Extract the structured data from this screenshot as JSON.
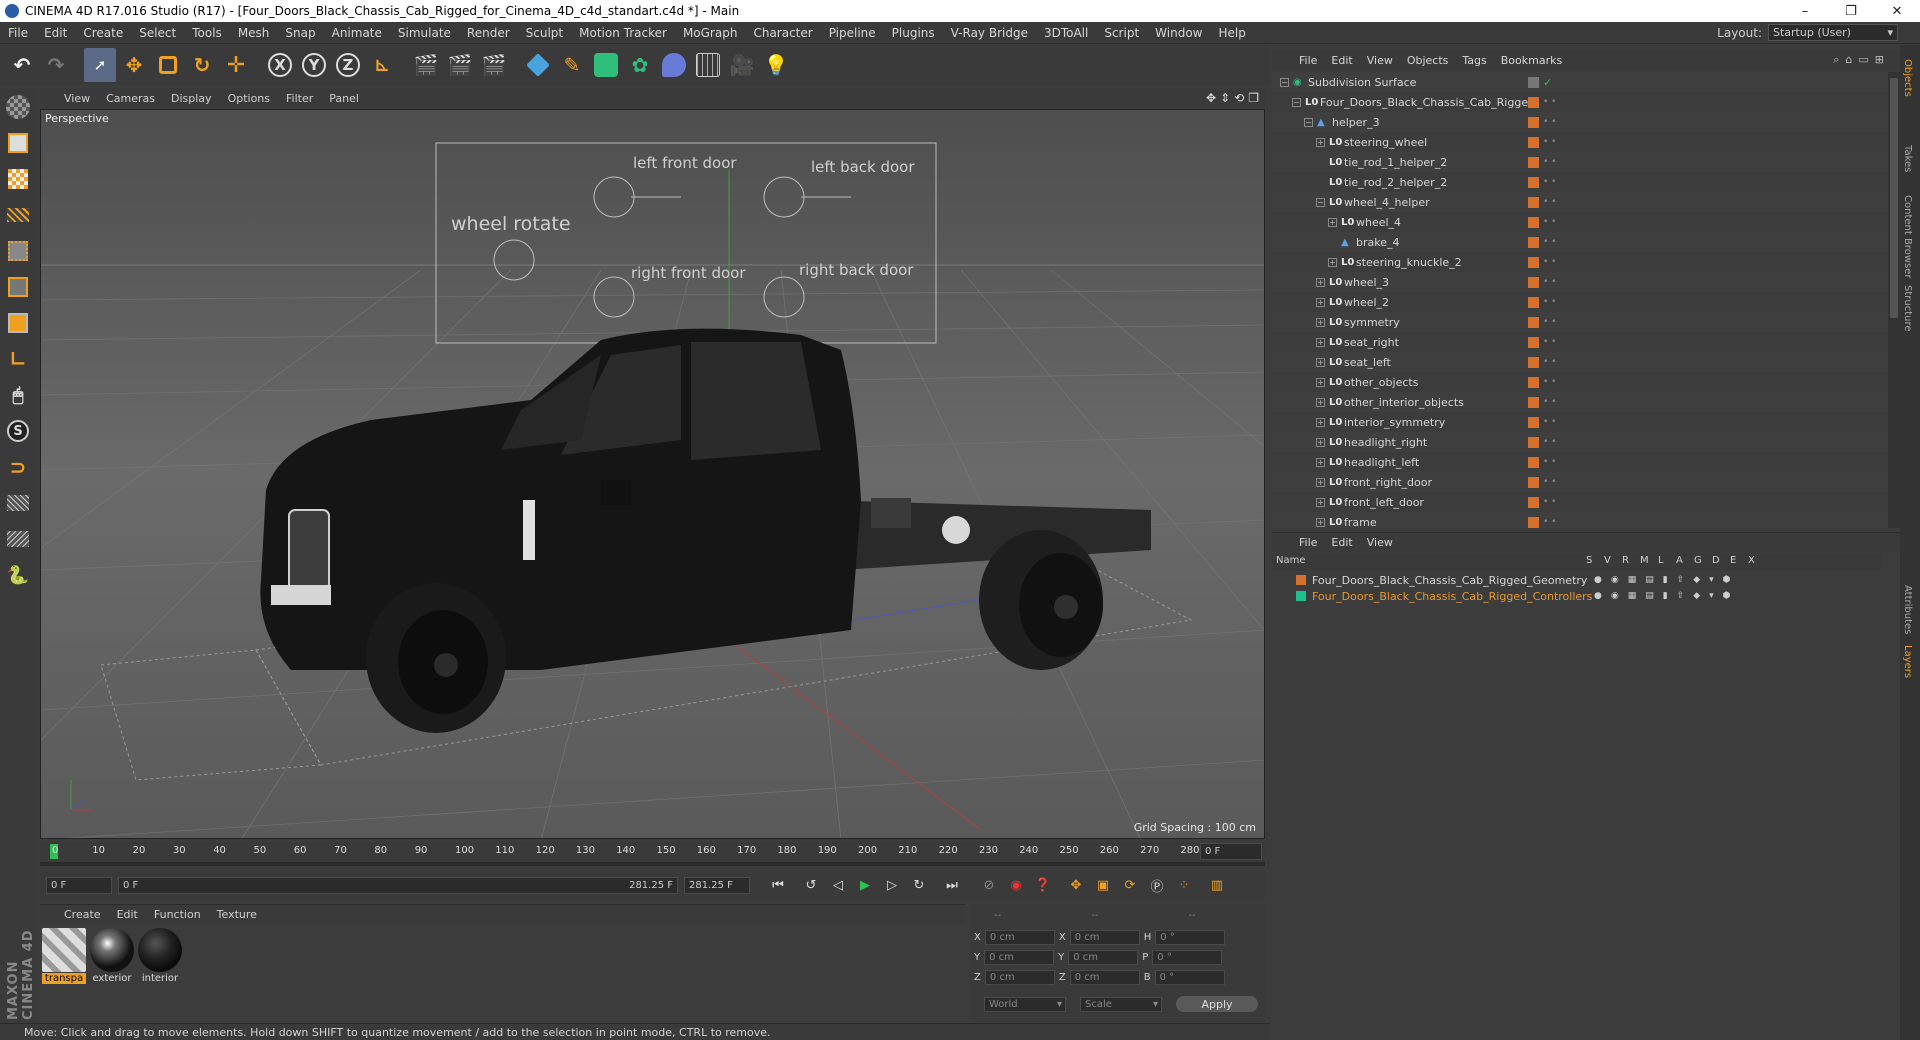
{
  "window": {
    "title": "CINEMA 4D R17.016 Studio (R17) - [Four_Doors_Black_Chassis_Cab_Rigged_for_Cinema_4D_c4d_standart.c4d *] - Main",
    "minimize": "–",
    "restore": "❐",
    "close": "✕"
  },
  "menubar": {
    "items": [
      "File",
      "Edit",
      "Create",
      "Select",
      "Tools",
      "Mesh",
      "Snap",
      "Animate",
      "Simulate",
      "Render",
      "Sculpt",
      "Motion Tracker",
      "MoGraph",
      "Character",
      "Pipeline",
      "Plugins",
      "V-Ray Bridge",
      "3DToAll",
      "Script",
      "Window",
      "Help"
    ],
    "layout_label": "Layout:",
    "layout_value": "Startup (User)"
  },
  "viewport": {
    "menu": [
      "View",
      "Cameras",
      "Display",
      "Options",
      "Filter",
      "Panel"
    ],
    "camera_label": "Perspective",
    "grid_spacing": "Grid Spacing : 100 cm",
    "rig_labels": {
      "wheel_rotate": "wheel rotate",
      "left_front_door": "left front door",
      "left_back_door": "left back door",
      "right_front_door": "right front door",
      "right_back_door": "right back door"
    }
  },
  "timeline": {
    "ticks": [
      "0",
      "10",
      "20",
      "30",
      "40",
      "50",
      "60",
      "70",
      "80",
      "90",
      "100",
      "110",
      "120",
      "130",
      "140",
      "150",
      "160",
      "170",
      "180",
      "190",
      "200",
      "210",
      "220",
      "230",
      "240",
      "250",
      "260",
      "270",
      "280"
    ],
    "current_frame": "0 F",
    "start_frame": "0 F",
    "slider_start": "0 F",
    "slider_end": "281.25 F",
    "end_frame": "281.25 F"
  },
  "materials": {
    "menu": [
      "Create",
      "Edit",
      "Function",
      "Texture"
    ],
    "items": [
      {
        "label": "transpa",
        "selected": true
      },
      {
        "label": "exterior",
        "selected": false
      },
      {
        "label": "interior",
        "selected": false
      }
    ]
  },
  "coordinates": {
    "headers": [
      "--",
      "--",
      "--"
    ],
    "rows": [
      {
        "a": "X",
        "av": "0 cm",
        "b": "X",
        "bv": "0 cm",
        "c": "H",
        "cv": "0 °"
      },
      {
        "a": "Y",
        "av": "0 cm",
        "b": "Y",
        "bv": "0 cm",
        "c": "P",
        "cv": "0 °"
      },
      {
        "a": "Z",
        "av": "0 cm",
        "b": "Z",
        "bv": "0 cm",
        "c": "B",
        "cv": "0 °"
      }
    ],
    "mode": "World",
    "transform": "Scale",
    "apply": "Apply"
  },
  "status": "Move: Click and drag to move elements. Hold down SHIFT to quantize movement / add to the selection in point mode, CTRL to remove.",
  "object_manager": {
    "menu": [
      "File",
      "Edit",
      "View",
      "Objects",
      "Tags",
      "Bookmarks"
    ],
    "rows": [
      {
        "name": "Subdivision Surface",
        "indent": 0,
        "icon": "subdiv",
        "expand": "−"
      },
      {
        "name": "Four_Doors_Black_Chassis_Cab_Rigged",
        "indent": 1,
        "icon": "null",
        "expand": "−"
      },
      {
        "name": "helper_3",
        "indent": 2,
        "icon": "joint",
        "expand": "−"
      },
      {
        "name": "steering_wheel",
        "indent": 3,
        "icon": "null",
        "expand": "+"
      },
      {
        "name": "tie_rod_1_helper_2",
        "indent": 3,
        "icon": "null",
        "expand": ""
      },
      {
        "name": "tie_rod_2_helper_2",
        "indent": 3,
        "icon": "null",
        "expand": ""
      },
      {
        "name": "wheel_4_helper",
        "indent": 3,
        "icon": "null",
        "expand": "−"
      },
      {
        "name": "wheel_4",
        "indent": 4,
        "icon": "null",
        "expand": "+"
      },
      {
        "name": "brake_4",
        "indent": 4,
        "icon": "joint",
        "expand": ""
      },
      {
        "name": "steering_knuckle_2",
        "indent": 4,
        "icon": "null",
        "expand": "+"
      },
      {
        "name": "wheel_3",
        "indent": 3,
        "icon": "null",
        "expand": "+"
      },
      {
        "name": "wheel_2",
        "indent": 3,
        "icon": "null",
        "expand": "+"
      },
      {
        "name": "symmetry",
        "indent": 3,
        "icon": "null",
        "expand": "+"
      },
      {
        "name": "seat_right",
        "indent": 3,
        "icon": "null",
        "expand": "+"
      },
      {
        "name": "seat_left",
        "indent": 3,
        "icon": "null",
        "expand": "+"
      },
      {
        "name": "other_objects",
        "indent": 3,
        "icon": "null",
        "expand": "+"
      },
      {
        "name": "other_interior_objects",
        "indent": 3,
        "icon": "null",
        "expand": "+"
      },
      {
        "name": "interior_symmetry",
        "indent": 3,
        "icon": "null",
        "expand": "+"
      },
      {
        "name": "headlight_right",
        "indent": 3,
        "icon": "null",
        "expand": "+"
      },
      {
        "name": "headlight_left",
        "indent": 3,
        "icon": "null",
        "expand": "+"
      },
      {
        "name": "front_right_door",
        "indent": 3,
        "icon": "null",
        "expand": "+"
      },
      {
        "name": "front_left_door",
        "indent": 3,
        "icon": "null",
        "expand": "+"
      },
      {
        "name": "frame",
        "indent": 3,
        "icon": "null",
        "expand": "+"
      }
    ]
  },
  "layer_manager": {
    "menu": [
      "File",
      "Edit",
      "View"
    ],
    "header": {
      "name": "Name",
      "cols": [
        "S",
        "V",
        "R",
        "M",
        "L",
        "A",
        "G",
        "D",
        "E",
        "X"
      ]
    },
    "layers": [
      {
        "name": "Four_Doors_Black_Chassis_Cab_Rigged_Geometry",
        "color": "#d6702d",
        "text_color": "#d6d6d6"
      },
      {
        "name": "Four_Doors_Black_Chassis_Cab_Rigged_Controllers",
        "color": "#1fbf8f",
        "text_color": "#e89a2a"
      }
    ]
  },
  "side_tabs": [
    "Objects",
    "Takes",
    "Content Browser",
    "Structure",
    "Attributes",
    "Layers"
  ],
  "brand": "MAXON CINEMA 4D"
}
